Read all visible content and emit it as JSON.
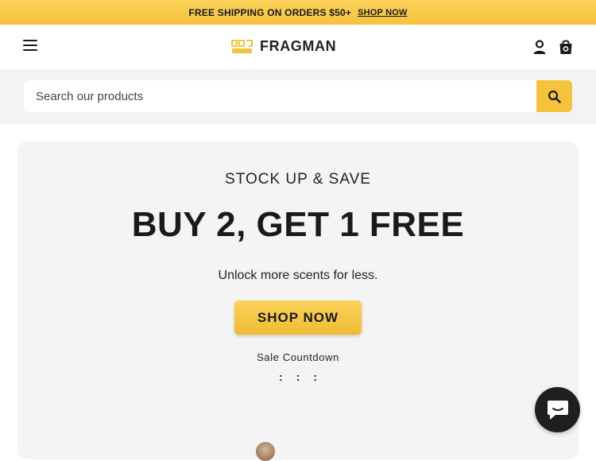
{
  "announcement": {
    "text": "FREE SHIPPING ON ORDERS $50+",
    "link_label": "SHOP NOW"
  },
  "header": {
    "logo_text": "FRAGMAN",
    "icons": [
      "menu-icon",
      "account-icon",
      "cart-icon"
    ]
  },
  "search": {
    "placeholder": "Search our products",
    "value": ""
  },
  "hero": {
    "eyebrow": "STOCK UP & SAVE",
    "headline": "BUY 2, GET 1 FREE",
    "subtext": "Unlock more scents for less.",
    "cta_label": "SHOP NOW",
    "countdown_label": "Sale Countdown",
    "countdown_separators": [
      ":",
      ":",
      ":"
    ]
  },
  "colors": {
    "accent": "#f5c23c",
    "hero_bg": "#f4f4f4",
    "search_band_bg": "#f3f3f3",
    "chat_button": "#1f1f1f"
  }
}
